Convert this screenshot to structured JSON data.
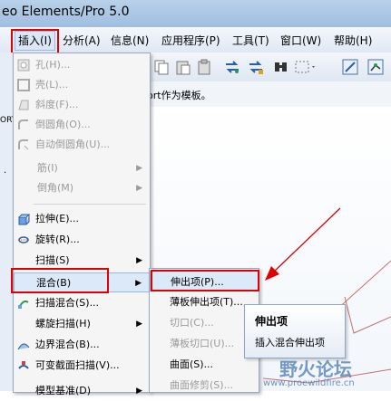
{
  "window": {
    "title": "eo Elements/Pro 5.0"
  },
  "menubar": {
    "items": [
      {
        "label": "插入(I)",
        "active": true
      },
      {
        "label": "分析(A)"
      },
      {
        "label": "信息(N)"
      },
      {
        "label": "应用程序(P)"
      },
      {
        "label": "工具(T)"
      },
      {
        "label": "窗口(W)"
      },
      {
        "label": "帮助(H)"
      }
    ]
  },
  "leftpanel": {
    "fragment_top": "ORT",
    "fragment_mid": "·"
  },
  "message": {
    "text": "ort作为模板。"
  },
  "insert_menu": {
    "items": [
      {
        "label": "孔(H)...",
        "disabled": true
      },
      {
        "label": "壳(L)...",
        "disabled": true
      },
      {
        "label": "斜度(F)...",
        "disabled": true
      },
      {
        "label": "倒圆角(O)...",
        "disabled": true
      },
      {
        "label": "自动倒圆角(U)...",
        "disabled": true
      },
      {
        "label": "筋(I)",
        "disabled": true,
        "submenu": true
      },
      {
        "label": "倒角(M)",
        "disabled": true,
        "submenu": true
      },
      {
        "label": "拉伸(E)..."
      },
      {
        "label": "旋转(R)..."
      },
      {
        "label": "扫描(S)",
        "submenu": true
      },
      {
        "label": "混合(B)",
        "submenu": true,
        "highlighted": true
      },
      {
        "label": "扫描混合(S)..."
      },
      {
        "label": "螺旋扫描(H)",
        "submenu": true
      },
      {
        "label": "边界混合(B)..."
      },
      {
        "label": "可变截面扫描(V)..."
      },
      {
        "label": "模型基准(D)",
        "submenu": true
      }
    ]
  },
  "blend_submenu": {
    "items": [
      {
        "label": "伸出项(P)...",
        "highlighted": true
      },
      {
        "label": "薄板伸出项(T)..."
      },
      {
        "label": "切口(C)...",
        "disabled": true
      },
      {
        "label": "薄板切口(U)...",
        "disabled": true
      },
      {
        "label": "曲面(S)..."
      },
      {
        "label": "曲面修剪(S)...",
        "disabled": true
      }
    ]
  },
  "tooltip": {
    "title": "伸出项",
    "description": "插入混合伸出项"
  },
  "watermark": {
    "text": "野火论坛",
    "url": "www.proewildfire.cn"
  },
  "colors": {
    "annotation_red": "#e00000",
    "highlight": "#dce9f9",
    "disabled_text": "#9a9a9a"
  }
}
